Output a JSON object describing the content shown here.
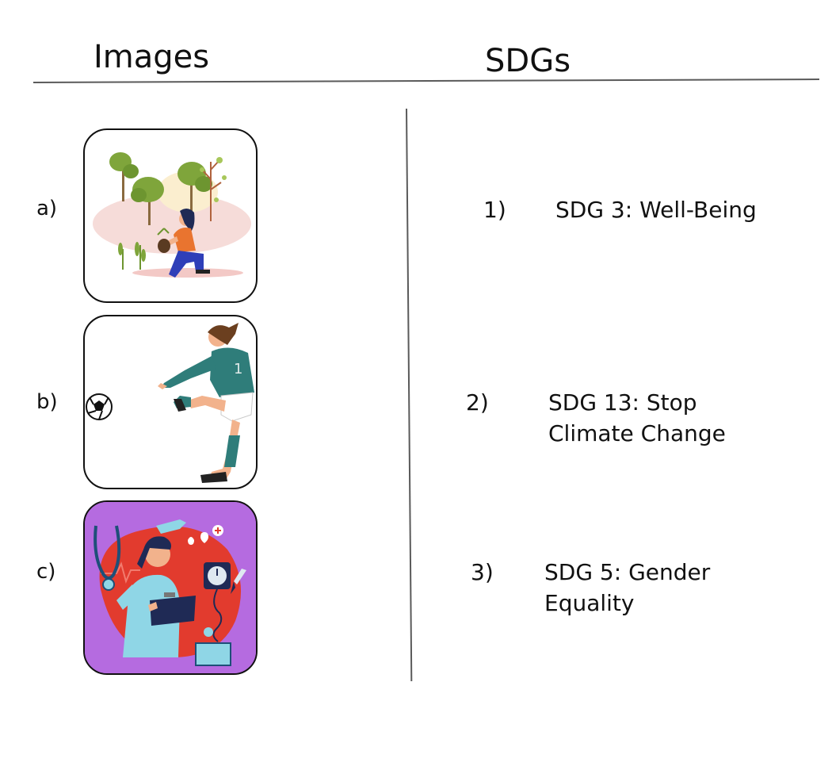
{
  "headers": {
    "images": "Images",
    "sdgs": "SDGs"
  },
  "images": [
    {
      "label": "a)",
      "icon": "tree-planting-illustration"
    },
    {
      "label": "b)",
      "icon": "soccer-player-illustration"
    },
    {
      "label": "c)",
      "icon": "health-worker-illustration"
    }
  ],
  "sdgs": [
    {
      "number": "1)",
      "line1": "SDG 3: Well-Being",
      "line2": ""
    },
    {
      "number": "2)",
      "line1": "SDG 13: Stop",
      "line2": "Climate Change"
    },
    {
      "number": "3)",
      "line1": "SDG 5: Gender",
      "line2": "Equality"
    }
  ],
  "colors": {
    "rule": "#5a5a5a",
    "card_c_background": "#b56be0",
    "card_c_blob": "#e23b2e"
  }
}
